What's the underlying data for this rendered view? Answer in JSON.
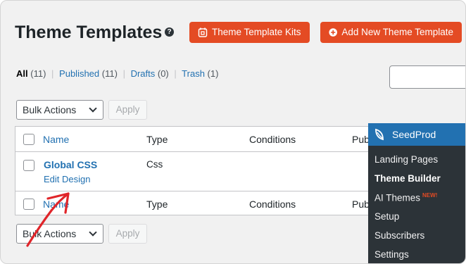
{
  "header": {
    "title": "Theme Templates",
    "help": "?",
    "kits_button": "Theme Template Kits",
    "add_button": "Add New Theme Template"
  },
  "filters": {
    "all": "All",
    "all_count": "(11)",
    "published": "Published",
    "published_count": "(11)",
    "drafts": "Drafts",
    "drafts_count": "(0)",
    "trash": "Trash",
    "trash_count": "(1)",
    "separator": "|"
  },
  "bulk": {
    "select_value": "Bulk Actions",
    "apply_label": "Apply"
  },
  "table": {
    "columns": [
      "Name",
      "Type",
      "Conditions",
      "Publ"
    ],
    "rows": [
      {
        "title": "Global CSS",
        "action": "Edit Design",
        "type": "Css"
      }
    ]
  },
  "seedprod_menu": {
    "title": "SeedProd",
    "items": [
      {
        "label": "Landing Pages",
        "active": false
      },
      {
        "label": "Theme Builder",
        "active": true
      },
      {
        "label": "AI Themes",
        "badge": "NEW!",
        "active": false
      },
      {
        "label": "Setup",
        "active": false
      },
      {
        "label": "Subscribers",
        "active": false
      },
      {
        "label": "Settings",
        "active": false
      }
    ]
  },
  "colors": {
    "accent": "#e44b24",
    "link": "#2271b1",
    "menu_bg": "#2c3338",
    "menu_header": "#2271b1",
    "annotation": "#e0252a"
  },
  "icons": {
    "kits": "template-kit-icon",
    "add": "plus-circle-icon",
    "help": "question-circle-icon",
    "dropdown": "chevron-down-icon",
    "brand": "seedprod-leaf-icon"
  }
}
